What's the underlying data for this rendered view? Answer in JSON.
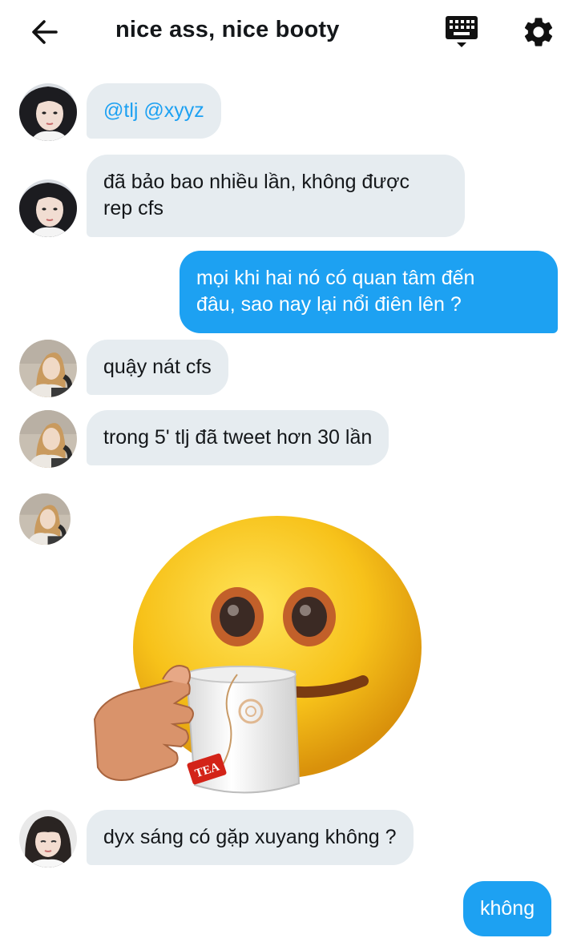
{
  "header": {
    "title": "nice ass, nice booty",
    "back_icon": "arrow-left-icon",
    "keyboard_icon": "keyboard-icon",
    "settings_icon": "gear-icon"
  },
  "colors": {
    "accent": "#1da1f2",
    "incoming_bubble": "#e6ecf0",
    "text": "#14171a"
  },
  "messages": [
    {
      "direction": "in",
      "sender": "user-a",
      "text": "@tlj @xyyz"
    },
    {
      "direction": "in",
      "sender": "user-a",
      "line1": "đã bảo bao nhiều lần, không được",
      "line2": "rep cfs"
    },
    {
      "direction": "out",
      "line1": "mọi khi hai nó có quan tâm đến",
      "line2": "đâu, sao nay lại nổi điên lên ?"
    },
    {
      "direction": "in",
      "sender": "user-b",
      "text": "quậy nát cfs"
    },
    {
      "direction": "in",
      "sender": "user-b",
      "text": "trong 5' tlj đã tweet hơn 30 lần"
    },
    {
      "direction": "in",
      "sender": "user-b",
      "type": "sticker",
      "sticker": "emoji-holding-tea-cup",
      "mug_label": "TEA"
    },
    {
      "direction": "in",
      "sender": "user-c",
      "text": "dyx sáng có gặp xuyang không ?"
    },
    {
      "direction": "out",
      "text": "không"
    }
  ]
}
